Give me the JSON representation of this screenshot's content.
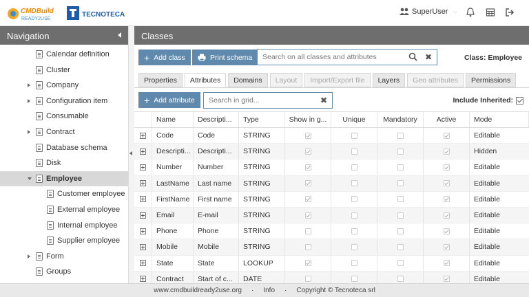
{
  "brand": {
    "logo1_line1": "CMDBuild",
    "logo1_line2": "READY2USE",
    "logo2": "TECNOTECA"
  },
  "topbar": {
    "user": "SuperUser"
  },
  "navigation": {
    "title": "Navigation",
    "items": [
      {
        "label": "Calendar definition",
        "expandable": false,
        "level": 0
      },
      {
        "label": "Cluster",
        "expandable": false,
        "level": 0
      },
      {
        "label": "Company",
        "expandable": true,
        "level": 0
      },
      {
        "label": "Configuration item",
        "expandable": true,
        "level": 0
      },
      {
        "label": "Consumable",
        "expandable": false,
        "level": 0
      },
      {
        "label": "Contract",
        "expandable": true,
        "level": 0
      },
      {
        "label": "Database schema",
        "expandable": false,
        "level": 0
      },
      {
        "label": "Disk",
        "expandable": false,
        "level": 0
      },
      {
        "label": "Employee",
        "expandable": true,
        "expanded": true,
        "selected": true,
        "level": 0
      },
      {
        "label": "Customer employee",
        "expandable": false,
        "level": 1
      },
      {
        "label": "External employee",
        "expandable": false,
        "level": 1
      },
      {
        "label": "Internal employee",
        "expandable": false,
        "level": 1
      },
      {
        "label": "Supplier employee",
        "expandable": false,
        "level": 1
      },
      {
        "label": "Form",
        "expandable": true,
        "level": 0
      },
      {
        "label": "Groups",
        "expandable": false,
        "level": 0
      }
    ]
  },
  "main": {
    "title": "Classes",
    "add_class": "Add class",
    "print_schema": "Print schema",
    "search_placeholder": "Search on all classes and attributes",
    "class_label": "Class:",
    "class_name": "Employee",
    "tabs": [
      {
        "label": "Properties",
        "state": "normal"
      },
      {
        "label": "Attributes",
        "state": "active"
      },
      {
        "label": "Domains",
        "state": "normal"
      },
      {
        "label": "Layout",
        "state": "disabled"
      },
      {
        "label": "Import/Export file",
        "state": "disabled"
      },
      {
        "label": "Layers",
        "state": "normal"
      },
      {
        "label": "Geo attributes",
        "state": "disabled"
      },
      {
        "label": "Permissions",
        "state": "normal"
      }
    ],
    "add_attribute": "Add attribute",
    "grid_search_placeholder": "Search in grid...",
    "include_inherited": "Include Inherited:",
    "include_inherited_checked": true
  },
  "grid": {
    "columns": [
      "Name",
      "Descripti...",
      "Type",
      "Show in g...",
      "Unique",
      "Mandatory",
      "Active",
      "Mode"
    ],
    "rows": [
      {
        "name": "Code",
        "description": "Code",
        "type": "STRING",
        "show_in_grid": true,
        "unique": false,
        "mandatory": false,
        "active": true,
        "mode": "Editable"
      },
      {
        "name": "Descripti...",
        "description": "Descripti...",
        "type": "STRING",
        "show_in_grid": true,
        "unique": false,
        "mandatory": false,
        "active": true,
        "mode": "Hidden"
      },
      {
        "name": "Number",
        "description": "Number",
        "type": "STRING",
        "show_in_grid": true,
        "unique": false,
        "mandatory": false,
        "active": true,
        "mode": "Editable"
      },
      {
        "name": "LastName",
        "description": "Last name",
        "type": "STRING",
        "show_in_grid": true,
        "unique": false,
        "mandatory": false,
        "active": true,
        "mode": "Editable"
      },
      {
        "name": "FirstName",
        "description": "First name",
        "type": "STRING",
        "show_in_grid": true,
        "unique": false,
        "mandatory": false,
        "active": true,
        "mode": "Editable"
      },
      {
        "name": "Email",
        "description": "E-mail",
        "type": "STRING",
        "show_in_grid": true,
        "unique": false,
        "mandatory": false,
        "active": true,
        "mode": "Editable"
      },
      {
        "name": "Phone",
        "description": "Phone",
        "type": "STRING",
        "show_in_grid": false,
        "unique": false,
        "mandatory": false,
        "active": true,
        "mode": "Editable"
      },
      {
        "name": "Mobile",
        "description": "Mobile",
        "type": "STRING",
        "show_in_grid": false,
        "unique": false,
        "mandatory": false,
        "active": true,
        "mode": "Editable"
      },
      {
        "name": "State",
        "description": "State",
        "type": "LOOKUP",
        "show_in_grid": true,
        "unique": false,
        "mandatory": false,
        "active": true,
        "mode": "Editable"
      },
      {
        "name": "Contract",
        "description": "Start of c...",
        "type": "DATE",
        "show_in_grid": false,
        "unique": false,
        "mandatory": false,
        "active": true,
        "mode": "Editable"
      }
    ]
  },
  "footer": {
    "site": "www.cmdbuildready2use.org",
    "sep": "·",
    "info": "Info",
    "copyright": "Copyright © Tecnoteca srl"
  },
  "colors": {
    "header_gray": "#6e6e6e",
    "accent_blue": "#5f8aad",
    "selected_row": "#d8d8d8"
  }
}
